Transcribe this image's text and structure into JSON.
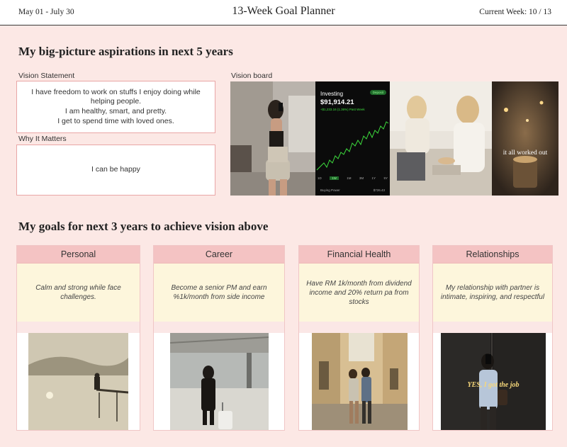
{
  "header": {
    "date_range": "May 01 - July 30",
    "title": "13-Week Goal Planner",
    "current_week": "Current Week:  10 / 13"
  },
  "aspirations": {
    "heading": "My big-picture aspirations in next 5 years",
    "vision_statement_label": "Vision Statement",
    "vision_statement_lines": [
      "I have freedom to work on stuffs I enjoy doing while helping people.",
      "I am healthy, smart, and pretty.",
      "I get to spend time with loved ones."
    ],
    "why_label": "Why It Matters",
    "why_text": "I can be happy",
    "vision_board_label": "Vision board",
    "investing": {
      "title": "Investing",
      "amount": "$91,914.21",
      "change": "+$1,233.16 (1.36%) Past Week",
      "badge": "Deposit",
      "ranges": [
        "1D",
        "1W",
        "1M",
        "3M",
        "1Y",
        "5Y"
      ],
      "buying_power_label": "Buying Power",
      "buying_power_value": "$726.43"
    },
    "overlay_text": "it all worked out"
  },
  "goals": {
    "heading": "My goals for next 3 years to achieve vision above",
    "cards": [
      {
        "title": "Personal",
        "text": "Calm and strong while face challenges."
      },
      {
        "title": "Career",
        "text": "Become a senior PM and earn %1k/month from side income"
      },
      {
        "title": "Financial Health",
        "text": "Have RM 1k/month from dividend income and 20% return pa from stocks"
      },
      {
        "title": "Relationships",
        "text": "My relationship with partner is intimate, inspiring, and respectful"
      }
    ],
    "photo_caption": "YES, I got the job"
  },
  "colors": {
    "background": "#fce8e5",
    "card_header": "#f4c3c3",
    "card_body": "#fdf6dc",
    "box_border": "#e9a6a6",
    "stock_green": "#3ddc3d"
  }
}
